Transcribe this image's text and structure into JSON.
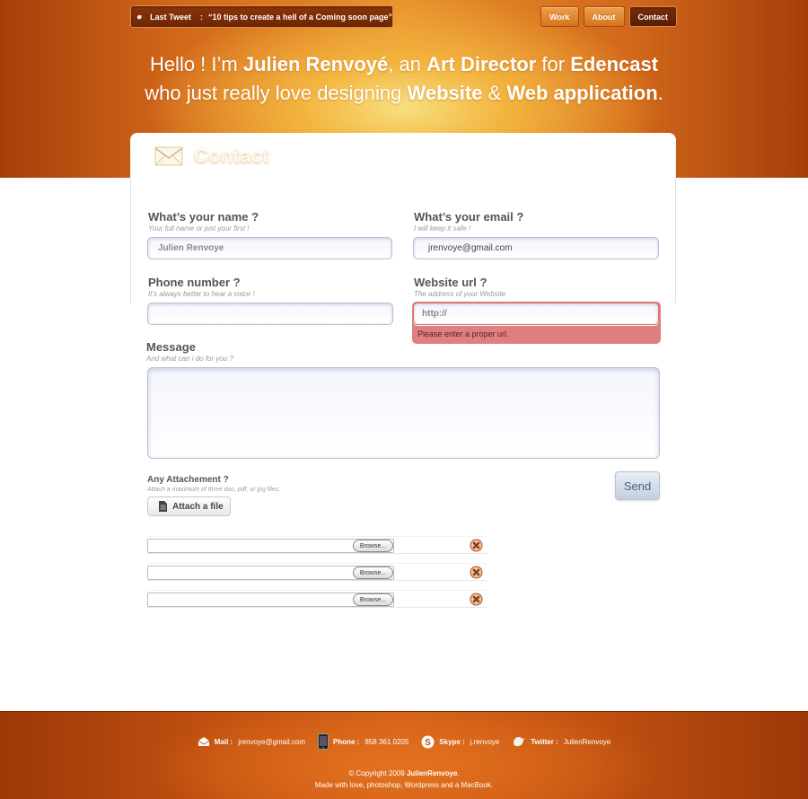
{
  "tweet": {
    "label": "Last Tweet",
    "separator": ":",
    "text": "“10 tips to create a hell of a Coming soon page”"
  },
  "nav": {
    "work": "Work",
    "about": "About",
    "contact": "Contact"
  },
  "headline": {
    "p1": "Hello ! I’m ",
    "name": "Julien Renvoyé",
    "p2": ", an ",
    "role": "Art Director",
    "p3": " for ",
    "company": "Edencast",
    "p4": "who just really love designing ",
    "w1": "Website",
    "p5": " & ",
    "w2": "Web application",
    "p6": "."
  },
  "contact": {
    "title": "Contact"
  },
  "form": {
    "name": {
      "label": "What’s your name ?",
      "hint": "Your full name or just your first !",
      "value": "Julien Renvoye"
    },
    "email": {
      "label": "What’s your email ?",
      "hint": "I will keep it safe !",
      "value": "jrenvoye@gmail.com"
    },
    "phone": {
      "label": "Phone number  ?",
      "hint": "It’s always better to hear a voice !",
      "value": ""
    },
    "website": {
      "label": "Website url ?",
      "hint": "The address of your Website",
      "value": "http://",
      "error": "Please enter a proper url."
    },
    "message": {
      "label": "Message",
      "hint": "And what can i do for you ?"
    },
    "attachment": {
      "label": "Any Attachement ?",
      "hint": "Attach a maximum of three doc, pdf, or jpg files.",
      "button": "Attach a file",
      "browse": "Browse..."
    },
    "send": "Send"
  },
  "footer": {
    "mail_label": "Mail :",
    "mail": "jrenvoye@gmail.com",
    "phone_label": "Phone :",
    "phone": "858 361 0205",
    "skype_label": "Skype :",
    "skype": "j.renvoye",
    "twitter_label": "Twitter :",
    "twitter": "JulienRenvoye",
    "copy_prefix": "© Copyright 2009 ",
    "copy_name": "JulienRenvoye",
    "copy_suffix": ".",
    "made_with": "Made with love, photoshop, Wordpress and a MacBook."
  }
}
